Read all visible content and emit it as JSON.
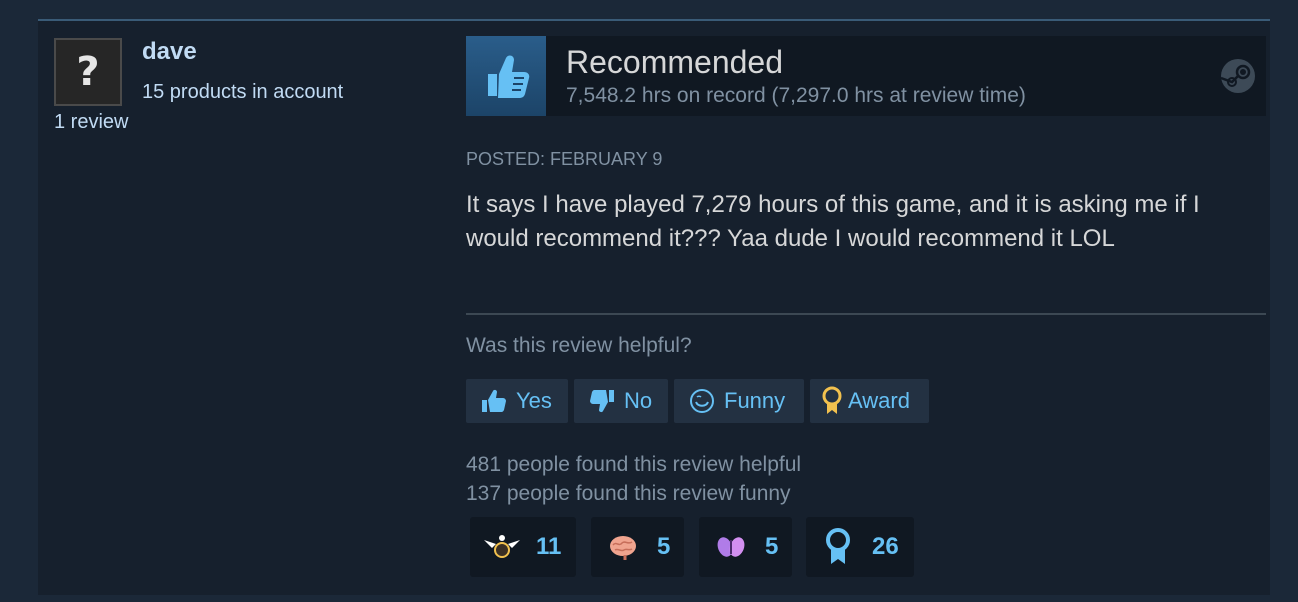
{
  "user": {
    "avatar_glyph": "?",
    "name": "dave",
    "products": "15 products in account",
    "reviews": "1 review"
  },
  "recommendation": {
    "title": "Recommended",
    "hours": "7,548.2 hrs on record (7,297.0 hrs at review time)",
    "icon": "thumbs-up-icon"
  },
  "review": {
    "posted": "POSTED: FEBRUARY 9",
    "text": "It says I have played 7,279 hours of this game, and it is asking me if I would recommend it??? Yaa dude I would recommend it LOL"
  },
  "feedback": {
    "question": "Was this review helpful?",
    "buttons": [
      {
        "label": "Yes",
        "icon": "thumbs-up-icon"
      },
      {
        "label": "No",
        "icon": "thumbs-down-icon"
      },
      {
        "label": "Funny",
        "icon": "smiley-icon"
      },
      {
        "label": "Award",
        "icon": "award-ribbon-icon"
      }
    ],
    "helpful_count": "481 people found this review helpful",
    "funny_count": "137 people found this review funny"
  },
  "awards": [
    {
      "icon": "winged-award-icon",
      "count": "11"
    },
    {
      "icon": "brain-icon",
      "count": "5"
    },
    {
      "icon": "butterfly-icon",
      "count": "5"
    },
    {
      "icon": "ribbon-medal-icon",
      "count": "26"
    }
  ],
  "colors": {
    "background": "#1b2838",
    "card": "#16202d",
    "accent": "#66c0f4",
    "text": "#d6d7d8",
    "muted": "#8091a2"
  }
}
